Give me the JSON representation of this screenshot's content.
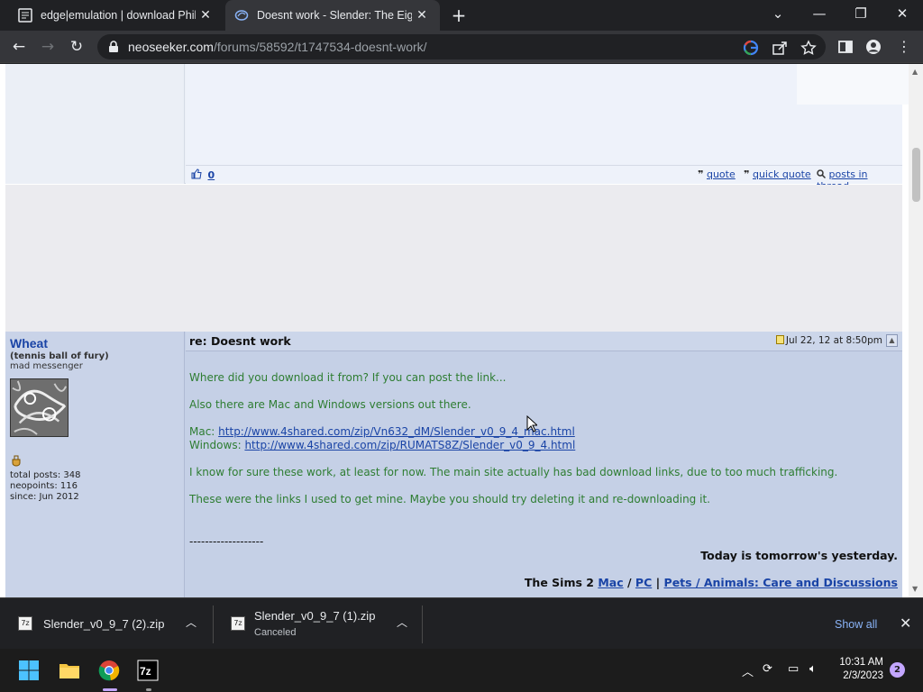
{
  "tabs": [
    {
      "title": "edge|emulation | download Philip",
      "active": false
    },
    {
      "title": "Doesnt work - Slender: The Eight",
      "active": true
    }
  ],
  "toolbar": {
    "url_host": "neoseeker.com",
    "url_path": "/forums/58592/t1747534-doesnt-work/"
  },
  "prev_post": {
    "likes": "0",
    "quote": "quote",
    "quick_quote": "quick quote",
    "posts_in_thread": "posts in thread"
  },
  "post": {
    "username": "Wheat",
    "user_title": "(tennis ball of fury)",
    "user_rank": "mad messenger",
    "total_posts": "total posts: 348",
    "neopoints": "neopoints: 116",
    "since": "since: Jun 2012",
    "subject": "re: Doesnt work",
    "date": "Jul 22, 12 at 8:50pm",
    "line1": "Where did you download it from? If you can post the link...",
    "line2": "Also there are Mac and Windows versions out there.",
    "mac_label": "Mac: ",
    "mac_link": "http://www.4shared.com/zip/Vn632_dM/Slender_v0_9_4_mac.html",
    "win_label": "Windows: ",
    "win_link": "http://www.4shared.com/zip/RUMATS8Z/Slender_v0_9_4.html",
    "line3": "I know for sure these work, at least for now. The main site actually has bad download links, due to too much trafficking.",
    "line4": "These were the links I used to get mine. Maybe you should try deleting it and re-downloading it.",
    "sig_divider": "-------------------",
    "sig_line1": "Today is tomorrow's yesterday.",
    "sig_prefix": "The Sims 2 ",
    "sig_mac": "Mac",
    "sig_sep1": " / ",
    "sig_pc": "PC",
    "sig_sep2": " | ",
    "sig_pets": "Pets / Animals: Care and Discussions"
  },
  "downloads": [
    {
      "name": "Slender_v0_9_7 (2).zip",
      "status": ""
    },
    {
      "name": "Slender_v0_9_7 (1).zip",
      "status": "Canceled"
    }
  ],
  "downloads_show_all": "Show all",
  "taskbar": {
    "time": "10:31 AM",
    "date": "2/3/2023",
    "notifications": "2"
  }
}
